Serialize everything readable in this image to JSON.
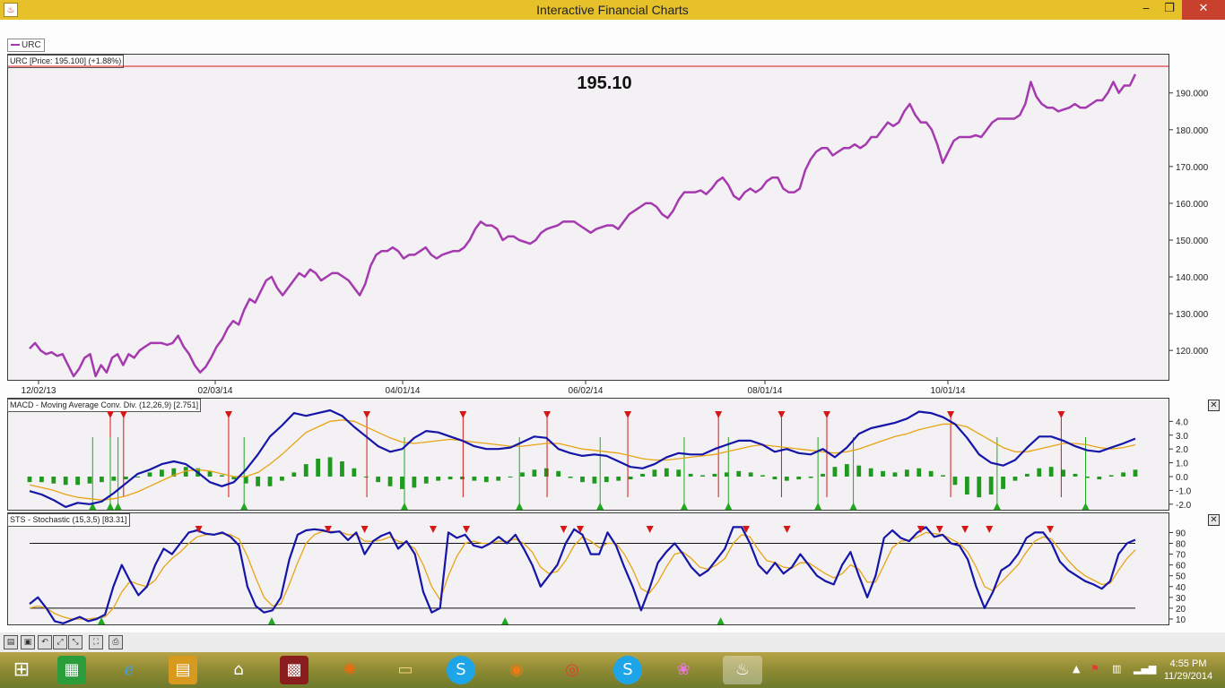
{
  "window": {
    "title": "Interactive Financial Charts",
    "app_icon": "java-icon",
    "minimize": "‒",
    "maximize": "❐",
    "close": "✕"
  },
  "legend": {
    "label": "URC"
  },
  "colors": {
    "price": "#a53ab0",
    "macd": "#1515a8",
    "signal": "#e8a413",
    "histogram": "#1f9a1f",
    "sell_marker": "#d81616",
    "buy_marker": "#1faa1f"
  },
  "price_panel": {
    "label": "URC [Price: 195.100] (+1.88%)",
    "last_price": "195.10",
    "x_labels": [
      "12/02/13",
      "02/03/14",
      "04/01/14",
      "06/02/14",
      "08/01/14",
      "10/01/14"
    ],
    "y_labels": [
      "120.000",
      "130.000",
      "140.000",
      "150.000",
      "160.000",
      "170.000",
      "180.000",
      "190.000"
    ]
  },
  "macd_panel": {
    "label": "MACD - Moving Average Conv. Div. (12,26,9) [2.751]",
    "y_labels": [
      "4.0",
      "3.0",
      "2.0",
      "1.0",
      "0.0",
      "-1.0",
      "-2.0"
    ],
    "close": "✕"
  },
  "sts_panel": {
    "label": "STS - Stochastic (15,3,5) [83.31]",
    "y_labels": [
      "90",
      "80",
      "70",
      "60",
      "50",
      "40",
      "30",
      "20",
      "10"
    ],
    "close": "✕"
  },
  "chart_data": [
    {
      "type": "line",
      "title": "URC [Price: 195.100] (+1.88%)",
      "ylim": [
        112,
        197
      ],
      "x_tick_labels": [
        "12/02/13",
        "02/03/14",
        "04/01/14",
        "06/02/14",
        "08/01/14",
        "10/01/14"
      ],
      "series": [
        {
          "name": "URC",
          "values": [
            120.5,
            122,
            120,
            119,
            119.5,
            118.5,
            119,
            116,
            113,
            115,
            118,
            119,
            113,
            116,
            114,
            118,
            119,
            116,
            119,
            118,
            120,
            121,
            122,
            122,
            122,
            121.5,
            122,
            124,
            121,
            119,
            116,
            114,
            115.5,
            118,
            121,
            123,
            126,
            128,
            127,
            131,
            134,
            133,
            136,
            139,
            140,
            137,
            135,
            137,
            139,
            141,
            140,
            142,
            141,
            139,
            140,
            141,
            141,
            140,
            139,
            137,
            135,
            138,
            143,
            146,
            147,
            147,
            148,
            147,
            145,
            146,
            146,
            147,
            148,
            146,
            145,
            146,
            146.5,
            147,
            147,
            148,
            150,
            153,
            155,
            154,
            154,
            153,
            150,
            151,
            151,
            150,
            149.5,
            149,
            150,
            152,
            153,
            153.5,
            154,
            155,
            155,
            155,
            154,
            153,
            152,
            153,
            153.5,
            154,
            154,
            153,
            155,
            157,
            158,
            159,
            160,
            160,
            159,
            157,
            156,
            158,
            161,
            163,
            163,
            163,
            163.5,
            162.5,
            164,
            166,
            167,
            165,
            162,
            161,
            163,
            164,
            163,
            164,
            166,
            167,
            167,
            164,
            163,
            163,
            164,
            169,
            172,
            174,
            175,
            175,
            173,
            174,
            175,
            175,
            176,
            175,
            176,
            178,
            178,
            180,
            182,
            181,
            182,
            185,
            187,
            184,
            182,
            182,
            180,
            176,
            171,
            174,
            177,
            178,
            178,
            178,
            178.5,
            178,
            180,
            182,
            183,
            183,
            183,
            183,
            184,
            187,
            193,
            189,
            187,
            186,
            186,
            185,
            185.5,
            186,
            187,
            186,
            186,
            187,
            188,
            188,
            190,
            193,
            190,
            192,
            192,
            195.1
          ]
        }
      ]
    },
    {
      "type": "line",
      "title": "MACD - Moving Average Conv. Div. (12,26,9) [2.751]",
      "ylim": [
        -2.4,
        4.8
      ],
      "series": [
        {
          "name": "MACD",
          "values": [
            -1.05,
            -1.3,
            -1.7,
            -2.2,
            -1.9,
            -2.0,
            -1.8,
            -1.2,
            -0.5,
            0.2,
            0.5,
            0.9,
            1.1,
            0.9,
            0.3,
            -0.4,
            -0.7,
            -0.4,
            0.5,
            1.6,
            2.9,
            3.7,
            4.6,
            4.4,
            4.6,
            4.8,
            4.4,
            3.6,
            2.9,
            2.2,
            1.8,
            2.0,
            2.8,
            3.3,
            3.2,
            2.9,
            2.6,
            2.2,
            2.0,
            2.0,
            2.1,
            2.5,
            2.9,
            2.8,
            2.0,
            1.7,
            1.5,
            1.6,
            1.5,
            1.1,
            0.7,
            0.6,
            0.9,
            1.4,
            1.7,
            1.6,
            1.6,
            2.0,
            2.3,
            2.6,
            2.6,
            2.3,
            1.8,
            2.0,
            1.7,
            1.6,
            2.0,
            1.4,
            2.1,
            3.1,
            3.5,
            3.7,
            3.9,
            4.2,
            4.7,
            4.6,
            4.3,
            3.8,
            2.8,
            1.6,
            1.0,
            0.8,
            1.2,
            2.1,
            2.9,
            2.9,
            2.6,
            2.2,
            1.9,
            1.8,
            2.1,
            2.4,
            2.75
          ]
        },
        {
          "name": "Signal",
          "values": [
            -0.6,
            -0.8,
            -1.0,
            -1.3,
            -1.5,
            -1.6,
            -1.7,
            -1.6,
            -1.4,
            -1.1,
            -0.7,
            -0.3,
            0.1,
            0.4,
            0.5,
            0.4,
            0.2,
            0.0,
            0.0,
            0.3,
            0.9,
            1.6,
            2.4,
            3.2,
            3.6,
            4.0,
            4.1,
            4.0,
            3.6,
            3.2,
            2.8,
            2.5,
            2.4,
            2.5,
            2.6,
            2.7,
            2.6,
            2.5,
            2.4,
            2.3,
            2.2,
            2.2,
            2.3,
            2.4,
            2.4,
            2.2,
            2.0,
            1.9,
            1.8,
            1.7,
            1.5,
            1.3,
            1.2,
            1.2,
            1.3,
            1.4,
            1.5,
            1.6,
            1.8,
            2.0,
            2.2,
            2.3,
            2.2,
            2.1,
            2.0,
            1.9,
            1.8,
            1.7,
            1.8,
            2.0,
            2.3,
            2.6,
            2.9,
            3.1,
            3.4,
            3.6,
            3.8,
            3.8,
            3.6,
            3.1,
            2.6,
            2.1,
            1.8,
            1.8,
            2.0,
            2.2,
            2.4,
            2.4,
            2.3,
            2.1,
            2.0,
            2.1,
            2.3
          ]
        }
      ],
      "histogram": [
        -0.4,
        -0.4,
        -0.5,
        -0.6,
        -0.6,
        -0.5,
        -0.4,
        -0.3,
        -0.2,
        0.0,
        0.3,
        0.5,
        0.6,
        0.7,
        0.6,
        0.4,
        0.1,
        -0.2,
        -0.5,
        -0.7,
        -0.7,
        -0.3,
        0.3,
        0.9,
        1.3,
        1.4,
        1.1,
        0.6,
        0.0,
        -0.4,
        -0.7,
        -0.9,
        -0.8,
        -0.5,
        -0.3,
        -0.2,
        -0.2,
        -0.3,
        -0.4,
        -0.3,
        0.0,
        0.3,
        0.5,
        0.6,
        0.4,
        -0.1,
        -0.4,
        -0.5,
        -0.4,
        -0.3,
        -0.2,
        0.2,
        0.5,
        0.6,
        0.5,
        0.2,
        0.1,
        0.2,
        0.3,
        0.4,
        0.3,
        0.1,
        -0.2,
        -0.3,
        -0.2,
        -0.1,
        0.2,
        0.7,
        0.9,
        0.8,
        0.6,
        0.4,
        0.3,
        0.5,
        0.6,
        0.4,
        0.1,
        -0.6,
        -1.3,
        -1.5,
        -1.3,
        -0.9,
        -0.3,
        0.2,
        0.6,
        0.7,
        0.5,
        0.2,
        -0.1,
        -0.2,
        0.1,
        0.3,
        0.5
      ],
      "sell_signals_at_x": [
        0.073,
        0.085,
        0.18,
        0.305,
        0.392,
        0.468,
        0.541,
        0.623,
        0.68,
        0.721,
        0.833,
        0.933
      ],
      "buy_signals_at_x": [
        0.057,
        0.073,
        0.08,
        0.194,
        0.339,
        0.443,
        0.516,
        0.592,
        0.632,
        0.713,
        0.745,
        0.875,
        0.955
      ]
    },
    {
      "type": "line",
      "title": "STS - Stochastic (15,3,5) [83.31]",
      "ylim": [
        5,
        97
      ],
      "reference_lines": [
        80,
        20
      ],
      "series": [
        {
          "name": "%K",
          "values": [
            24,
            30,
            20,
            8,
            6,
            9,
            12,
            8,
            10,
            14,
            40,
            60,
            45,
            32,
            40,
            60,
            75,
            70,
            80,
            90,
            92,
            89,
            88,
            90,
            86,
            78,
            40,
            22,
            16,
            18,
            30,
            65,
            88,
            92,
            93,
            92,
            90,
            91,
            83,
            90,
            70,
            82,
            87,
            90,
            75,
            82,
            70,
            35,
            16,
            20,
            90,
            85,
            88,
            78,
            76,
            80,
            86,
            80,
            88,
            75,
            60,
            40,
            50,
            60,
            80,
            93,
            88,
            70,
            70,
            90,
            78,
            58,
            40,
            18,
            38,
            62,
            72,
            80,
            70,
            58,
            50,
            55,
            65,
            75,
            95,
            95,
            80,
            60,
            52,
            62,
            52,
            58,
            70,
            60,
            50,
            45,
            42,
            60,
            72,
            50,
            30,
            50,
            85,
            92,
            85,
            82,
            90,
            95,
            86,
            88,
            80,
            78,
            65,
            40,
            20,
            35,
            55,
            60,
            70,
            85,
            90,
            90,
            80,
            63,
            55,
            50,
            45,
            42,
            38,
            45,
            70,
            80,
            83.31
          ]
        },
        {
          "name": "%D",
          "values": [
            20,
            22,
            20,
            15,
            12,
            10,
            10,
            10,
            11,
            12,
            20,
            35,
            45,
            42,
            40,
            46,
            58,
            66,
            72,
            80,
            86,
            88,
            88,
            89,
            88,
            84,
            68,
            48,
            30,
            22,
            24,
            42,
            62,
            80,
            88,
            91,
            91,
            91,
            88,
            88,
            82,
            82,
            83,
            86,
            82,
            80,
            75,
            60,
            40,
            28,
            50,
            68,
            80,
            82,
            80,
            80,
            82,
            82,
            84,
            80,
            72,
            58,
            52,
            54,
            64,
            78,
            86,
            82,
            76,
            80,
            80,
            70,
            56,
            38,
            34,
            44,
            58,
            70,
            72,
            66,
            58,
            56,
            60,
            66,
            80,
            88,
            86,
            74,
            64,
            62,
            58,
            57,
            62,
            62,
            57,
            52,
            48,
            52,
            60,
            56,
            44,
            44,
            60,
            76,
            82,
            83,
            86,
            90,
            89,
            88,
            84,
            80,
            72,
            58,
            40,
            36,
            44,
            52,
            60,
            72,
            82,
            86,
            84,
            74,
            64,
            56,
            50,
            46,
            42,
            43,
            55,
            66,
            74
          ]
        }
      ],
      "sell_signals_at_x": [
        0.153,
        0.27,
        0.303,
        0.365,
        0.395,
        0.483,
        0.498,
        0.561,
        0.648,
        0.685,
        0.806,
        0.823,
        0.846,
        0.868,
        0.923
      ],
      "buy_signals_at_x": [
        0.065,
        0.219,
        0.43,
        0.625
      ]
    }
  ],
  "toolbar": {
    "buttons": [
      "open-icon",
      "save-icon",
      "undo-icon",
      "zoom-in-icon",
      "zoom-out-icon",
      "fit-icon",
      "print-icon"
    ]
  },
  "taskbar": {
    "time": "4:55 PM",
    "date": "11/29/2014"
  }
}
